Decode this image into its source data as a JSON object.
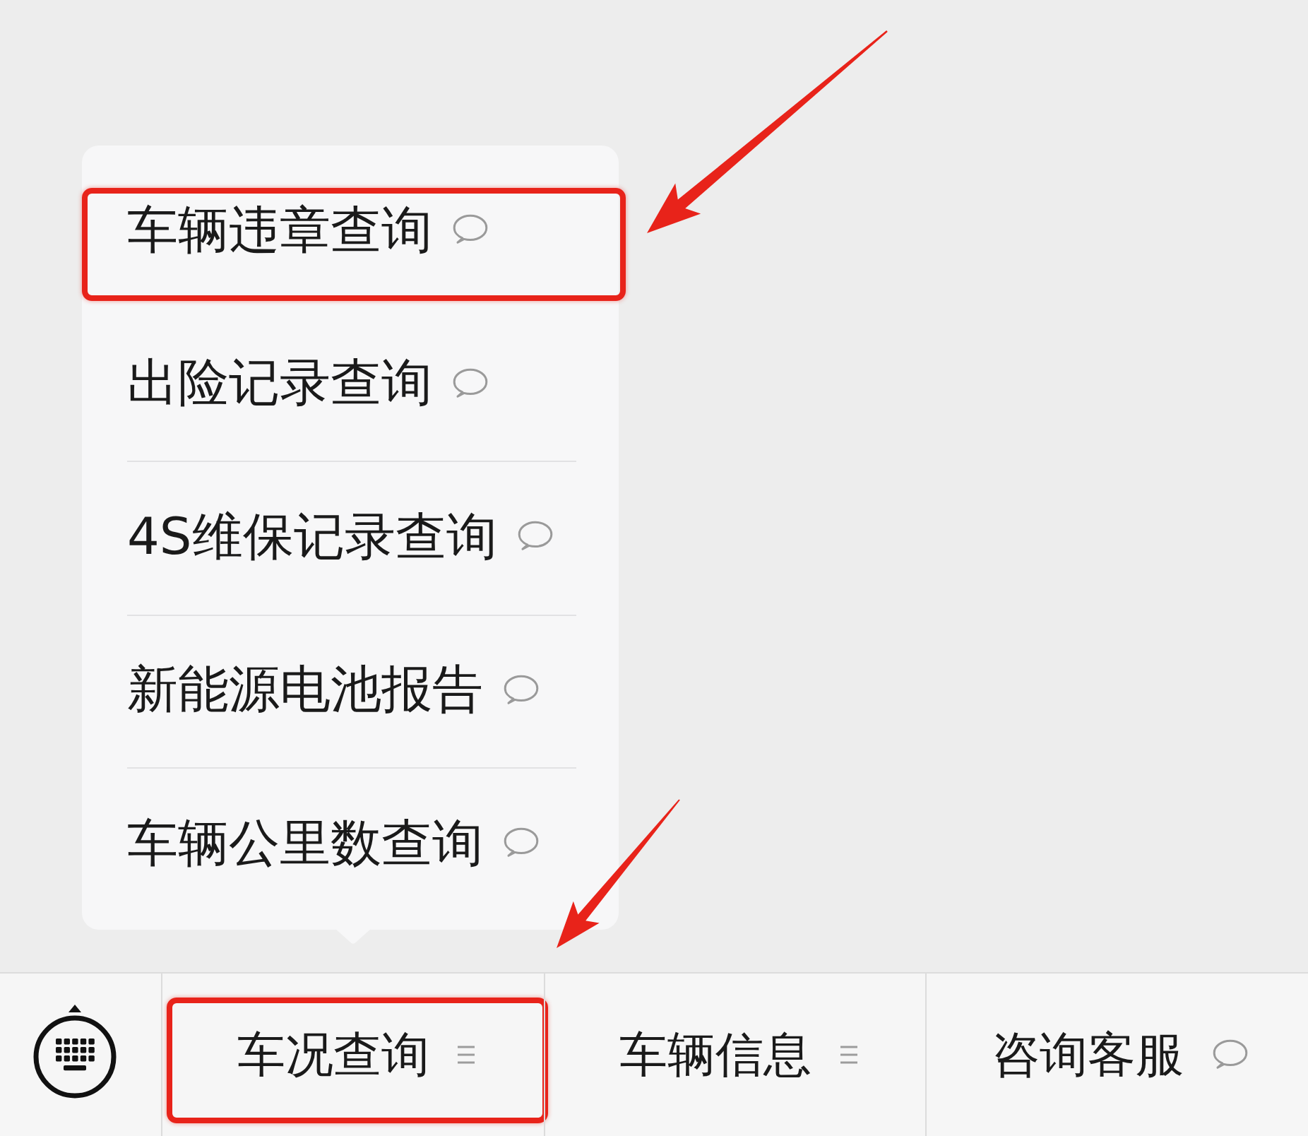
{
  "bottom_menu": {
    "tabs": [
      {
        "label": "车况查询",
        "kind": "submenu",
        "open": true,
        "highlighted": true,
        "submenu": [
          {
            "label": "车辆违章查询",
            "highlighted": true
          },
          {
            "label": "出险记录查询",
            "highlighted": false
          },
          {
            "label": "4S维保记录查询",
            "highlighted": false
          },
          {
            "label": "新能源电池报告",
            "highlighted": false
          },
          {
            "label": "车辆公里数查询",
            "highlighted": false
          }
        ]
      },
      {
        "label": "车辆信息",
        "kind": "submenu",
        "open": false,
        "highlighted": false
      },
      {
        "label": "咨询客服",
        "kind": "message",
        "highlighted": false
      }
    ]
  }
}
